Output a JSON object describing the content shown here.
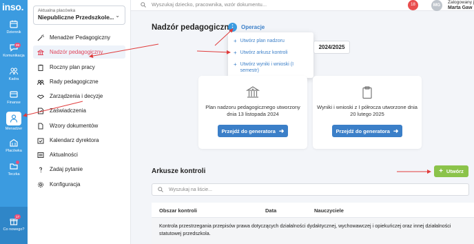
{
  "rail": {
    "logo": "inso.",
    "items": [
      {
        "label": "Dziennik",
        "icon": "calendar-icon"
      },
      {
        "label": "Komunikacja",
        "icon": "chat-icon",
        "badge": "99"
      },
      {
        "label": "Kadra",
        "icon": "people-icon"
      },
      {
        "label": "Finanse",
        "icon": "wallet-icon"
      },
      {
        "label": "Menadżer",
        "icon": "manager-icon"
      },
      {
        "label": "Placówka",
        "icon": "building-icon"
      },
      {
        "label": "Teczka",
        "icon": "folder-icon"
      },
      {
        "label": "Co nowego?",
        "icon": "gift-icon",
        "badge": "17"
      }
    ]
  },
  "sidebar": {
    "facility_caption": "Aktualna placówka",
    "facility_name": "Niepubliczne Przedszkole...",
    "items": [
      {
        "label": "Menadżer Pedagogiczny",
        "icon": "wand-icon"
      },
      {
        "label": "Nadzór pedagogiczny",
        "icon": "institution-icon"
      },
      {
        "label": "Roczny plan pracy",
        "icon": "clipboard-icon"
      },
      {
        "label": "Rady pedagogiczne",
        "icon": "group-icon"
      },
      {
        "label": "Zarządzenia i decyzje",
        "icon": "handshake-icon"
      },
      {
        "label": "Zaświadczenia",
        "icon": "certificate-icon"
      },
      {
        "label": "Wzory dokumentów",
        "icon": "document-icon"
      },
      {
        "label": "Kalendarz dyrektora",
        "icon": "calendar-check-icon"
      },
      {
        "label": "Aktualności",
        "icon": "news-icon"
      },
      {
        "label": "Zadaj pytanie",
        "icon": "question-icon"
      },
      {
        "label": "Konfiguracja",
        "icon": "gear-icon"
      }
    ]
  },
  "topbar": {
    "search_placeholder": "Wyszukaj dziecko, pracownika, wzór dokumentu...",
    "notifications": "18",
    "avatar_initials": "MG",
    "logged_caption": "Zalogowany j",
    "user_name": "Marta Gaw"
  },
  "main": {
    "title": "Nadzór pedagogiczny",
    "operations_label": "Operacje",
    "operations_menu": [
      "Utwórz plan nadzoru",
      "Utwórz arkusz kontroli",
      "Utwórz wyniki i wnioski (I semestr)"
    ],
    "school_year": "2024/2025",
    "cards": [
      {
        "text": "Plan nadzoru pedagogicznego utworzony dnia 13 listopada 2024",
        "button": "Przejdź do generatora",
        "icon": "institution-icon"
      },
      {
        "text": "Wyniki i wnioski z I półrocza utworzone dnia 20 lutego 2025",
        "button": "Przejdź do generatora",
        "icon": "clipboard-icon"
      }
    ],
    "section_title": "Arkusze kontroli",
    "create_button": "Utwórz",
    "list_search_placeholder": "Wyszukaj na liście...",
    "table": {
      "headers": [
        "Obszar kontroli",
        "Data",
        "Nauczyciele"
      ],
      "rows": [
        [
          "Kontrola przestrzegania przepisów prawa dotyczących działalności dydaktycznej, wychowawczej i opiekuńczej oraz innej działalności statutowej przedszkola.",
          "",
          ""
        ]
      ]
    }
  },
  "colors": {
    "rail": "#3b9be0",
    "accent": "#3b7fc8",
    "active_text": "#e0445a",
    "create": "#8bc34a",
    "annotation": "#e03b3b"
  }
}
